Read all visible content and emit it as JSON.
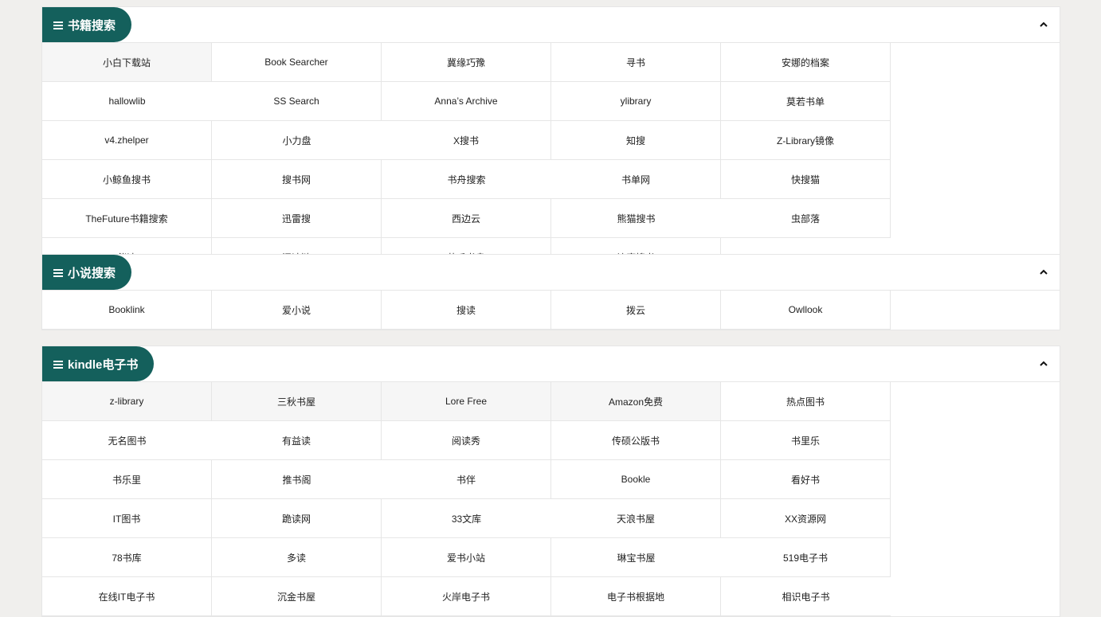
{
  "sections": [
    {
      "title": "书籍搜索",
      "items": [
        "小白下载站",
        "Book Searcher",
        "冀缘巧豫",
        "寻书",
        "安娜的档案",
        "hallowlib",
        "SS Search",
        "Anna’s Archive",
        "ylibrary",
        "莫若书单",
        "v4.zhelper",
        "小力盘",
        "X搜书",
        "知搜",
        "Z-Library镜像",
        "小鲸鱼搜书",
        "搜书网",
        "书舟搜索",
        "书单网",
        "快搜猫",
        "TheFuture书籍搜索",
        "迅雷搜",
        "西边云",
        "熊猫搜书",
        "虫部落",
        "伴读",
        "阅读链",
        "苦瓜书盘",
        "鸠摩搜书"
      ]
    },
    {
      "title": "小说搜索",
      "items": [
        "Booklink",
        "爱小说",
        "搜读",
        "拨云",
        "Owllook"
      ]
    },
    {
      "title": "kindle电子书",
      "items": [
        "z-library",
        "三秋书屋",
        "Lore Free",
        "Amazon免费",
        "热点图书",
        "无名图书",
        "有益读",
        "阅读秀",
        "传硕公版书",
        "书里乐",
        "书乐里",
        "推书阁",
        "书伴",
        "Bookle",
        "看好书",
        "IT图书",
        "跪读网",
        "33文库",
        "天浪书屋",
        "XX资源网",
        "78书库",
        "多读",
        "爱书小站",
        "琳宝书屋",
        "519电子书",
        "在线IT电子书",
        "沉金书屋",
        "火岸电子书",
        "电子书根据地",
        "相识电子书"
      ]
    }
  ]
}
